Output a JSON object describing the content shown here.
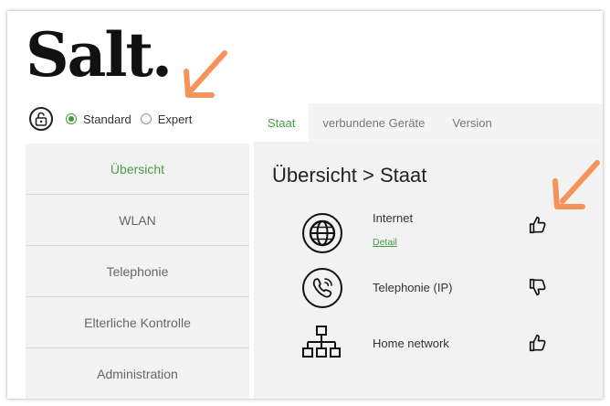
{
  "brand": {
    "logo_text": "Salt."
  },
  "mode": {
    "options": [
      {
        "label": "Standard",
        "selected": true
      },
      {
        "label": "Expert",
        "selected": false
      }
    ]
  },
  "sidebar": {
    "items": [
      {
        "label": "Übersicht",
        "active": true
      },
      {
        "label": "WLAN",
        "active": false
      },
      {
        "label": "Telephonie",
        "active": false
      },
      {
        "label": "Elterliche Kontrolle",
        "active": false
      },
      {
        "label": "Administration",
        "active": false
      }
    ]
  },
  "tabs": [
    {
      "label": "Staat",
      "active": true
    },
    {
      "label": "verbundene Geräte",
      "active": false
    },
    {
      "label": "Version",
      "active": false
    }
  ],
  "main": {
    "title": "Übersicht > Staat",
    "services": [
      {
        "label": "Internet",
        "icon": "globe-icon",
        "status": "thumbs-up-icon",
        "link": "Detail"
      },
      {
        "label": "Telephonie (IP)",
        "icon": "phone-icon",
        "status": "thumbs-down-icon"
      },
      {
        "label": "Home network",
        "icon": "network-icon",
        "status": "thumbs-up-icon"
      }
    ]
  },
  "colors": {
    "accent": "#4a9a45",
    "annotation": "#f5935a"
  }
}
